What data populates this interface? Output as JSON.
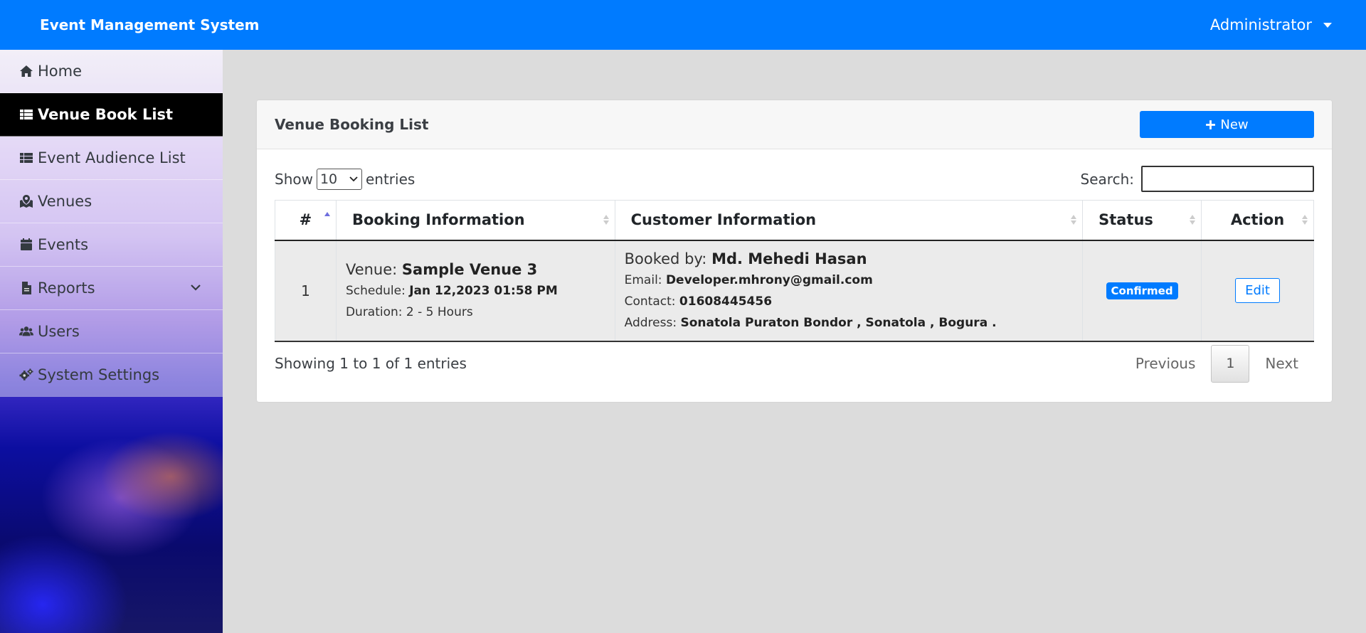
{
  "navbar": {
    "brand": "Event Management System",
    "user": "Administrator"
  },
  "sidebar": {
    "items": [
      {
        "label": "Home",
        "icon": "home-icon",
        "active": false
      },
      {
        "label": "Venue Book List",
        "icon": "table-icon",
        "active": true
      },
      {
        "label": "Event Audience List",
        "icon": "table-icon",
        "active": false
      },
      {
        "label": "Venues",
        "icon": "map-marked-icon",
        "active": false
      },
      {
        "label": "Events",
        "icon": "calendar-icon",
        "active": false
      },
      {
        "label": "Reports",
        "icon": "file-icon",
        "active": false,
        "has_submenu": true
      },
      {
        "label": "Users",
        "icon": "users-icon",
        "active": false
      },
      {
        "label": "System Settings",
        "icon": "cogs-icon",
        "active": false
      }
    ]
  },
  "panel": {
    "title": "Venue Booking List",
    "new_button": "New"
  },
  "controls": {
    "show_label": "Show",
    "entries_value": "10",
    "entries_label": "entries",
    "search_label": "Search:",
    "search_value": ""
  },
  "table": {
    "headers": [
      "#",
      "Booking Information",
      "Customer Information",
      "Status",
      "Action"
    ],
    "rows": [
      {
        "num": "1",
        "venue_label": "Venue:",
        "venue": "Sample Venue 3",
        "schedule_label": "Schedule:",
        "schedule": "Jan 12,2023 01:58 PM",
        "duration": "Duration: 2 - 5 Hours",
        "booked_by_label": "Booked by:",
        "booked_by": "Md. Mehedi Hasan",
        "email_label": "Email:",
        "email": "Developer.mhrony@gmail.com",
        "contact_label": "Contact:",
        "contact": "01608445456",
        "address_label": "Address:",
        "address": "Sonatola Puraton Bondor , Sonatola , Bogura .",
        "status": "Confirmed",
        "action": "Edit"
      }
    ]
  },
  "footer": {
    "info": "Showing 1 to 1 of 1 entries",
    "previous": "Previous",
    "page": "1",
    "next": "Next"
  },
  "colors": {
    "primary": "#007bff",
    "active_nav": "#000000",
    "page_bg": "#dcdcdc"
  }
}
